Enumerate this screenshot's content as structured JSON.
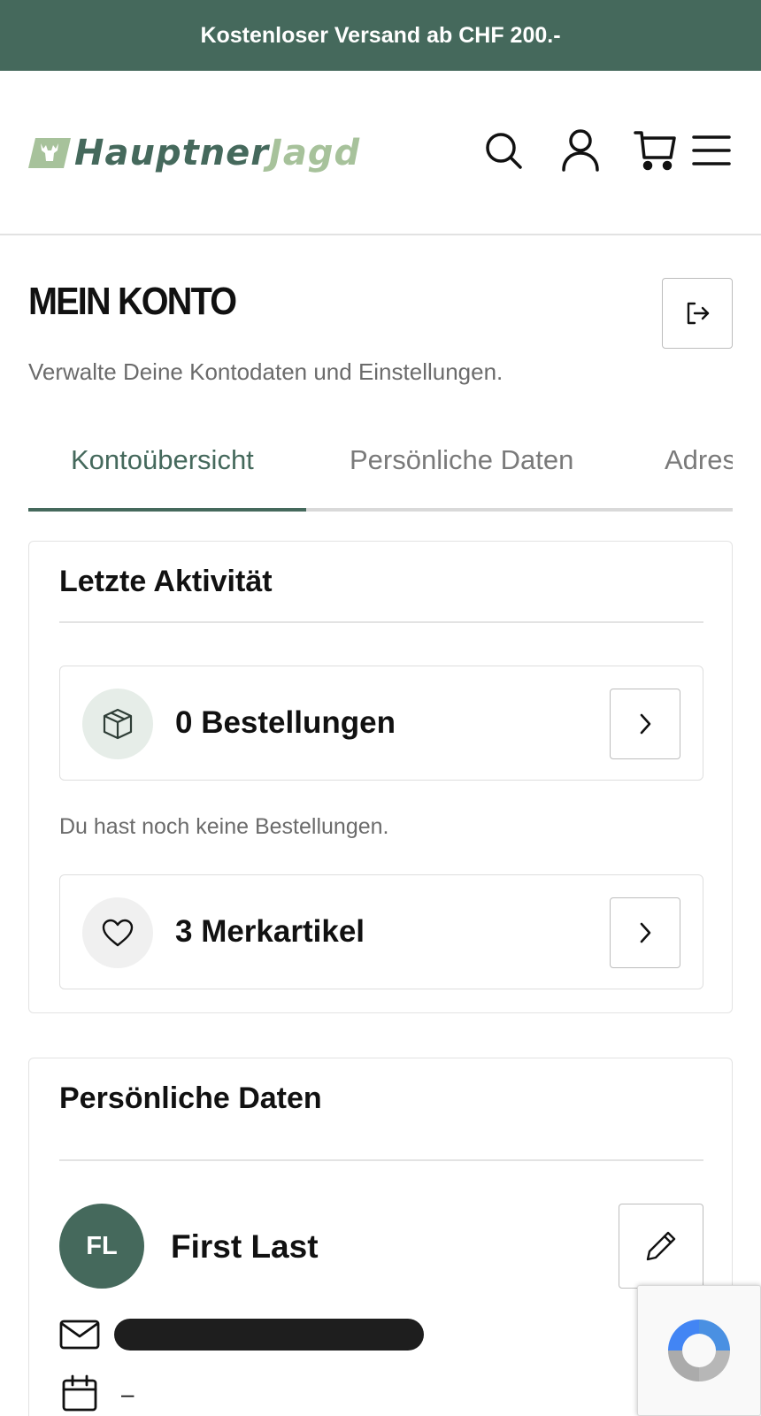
{
  "promo_bar": {
    "text": "Kostenloser Versand ab CHF 200.-"
  },
  "header": {
    "logo": {
      "word1": "Hauptner",
      "word2": "Jagd"
    },
    "icons": [
      "search-icon",
      "user-icon",
      "cart-icon",
      "menu-icon"
    ]
  },
  "page": {
    "title": "MEIN KONTO",
    "subtitle": "Verwalte Deine Kontodaten und Einstellungen."
  },
  "tabs": [
    {
      "label": "Kontoübersicht",
      "active": true
    },
    {
      "label": "Persönliche Daten",
      "active": false
    },
    {
      "label": "Adressen",
      "active": false
    }
  ],
  "activity": {
    "title": "Letzte Aktivität",
    "orders": {
      "label": "0 Bestellungen",
      "icon": "package-icon"
    },
    "orders_note": "Du hast noch keine Bestellungen.",
    "wishlist": {
      "label": "3 Merkartikel",
      "icon": "heart-icon"
    }
  },
  "personal": {
    "title": "Persönliche Daten",
    "initials": "FL",
    "name": "First Last",
    "email_icon": "mail-icon",
    "birthday_icon": "calendar-icon",
    "birthday": "–"
  },
  "colors": {
    "brand_green": "#45695c",
    "logo_light_green": "#a7c29b",
    "muted_text": "#6b6b6b"
  }
}
